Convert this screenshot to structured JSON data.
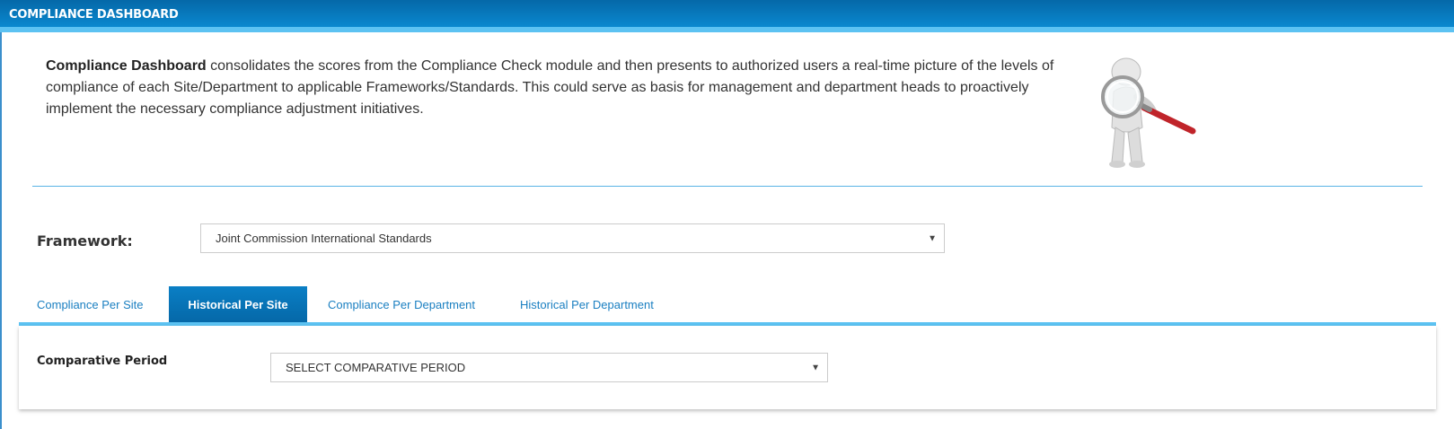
{
  "header": {
    "title": "COMPLIANCE DASHBOARD"
  },
  "intro": {
    "bold": "Compliance Dashboard",
    "text": " consolidates the scores from the Compliance Check module and then presents to authorized users a real-time picture of the levels of compliance of each Site/Department to applicable Frameworks/Standards. This could serve as basis for management and department heads to proactively implement the necessary compliance adjustment initiatives."
  },
  "mascot": {
    "icon": "magnifier-figure-icon"
  },
  "framework": {
    "label": "Framework:",
    "selected": "Joint Commission International Standards"
  },
  "tabs": [
    {
      "label": "Compliance Per Site",
      "active": false
    },
    {
      "label": "Historical Per Site",
      "active": true
    },
    {
      "label": "Compliance Per Department",
      "active": false
    },
    {
      "label": "Historical Per Department",
      "active": false
    }
  ],
  "comparative": {
    "label": "Comparative Period",
    "selected": "SELECT COMPARATIVE PERIOD"
  },
  "colors": {
    "header": "#0a88cf",
    "accent": "#5cc2f2",
    "link": "#1a7fc1"
  }
}
